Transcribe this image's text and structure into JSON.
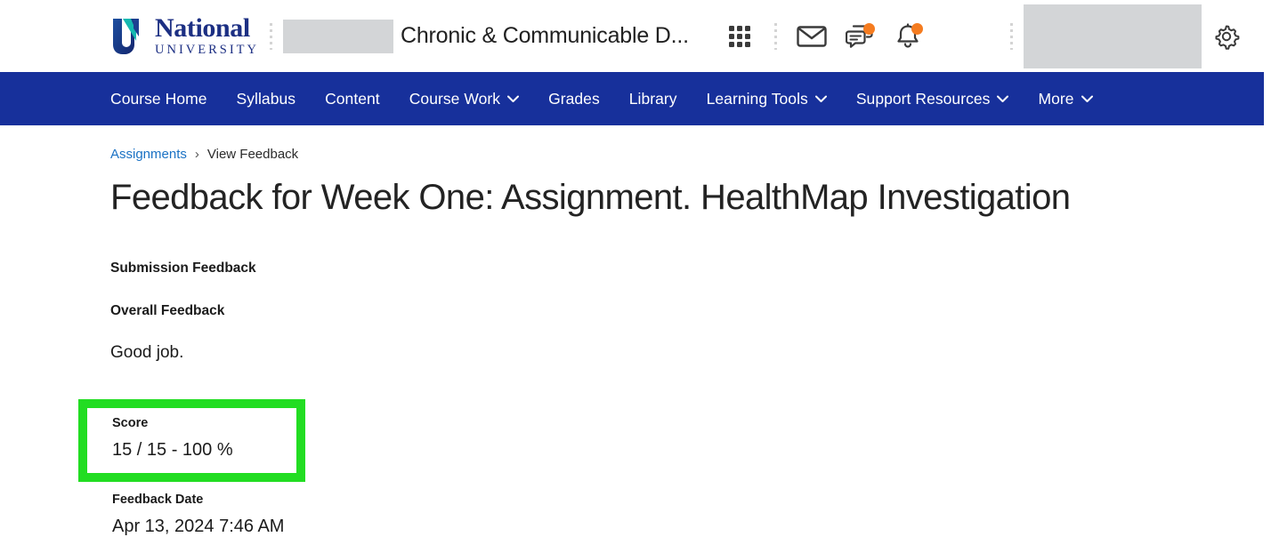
{
  "header": {
    "brand": {
      "name": "National",
      "sub": "UNIVERSITY",
      "logo_icon": "national-university-n-logo"
    },
    "course_title": "Chronic & Communicable D...",
    "redacted_course_label": "",
    "redacted_user_label": "",
    "icons": [
      {
        "name": "apps-grid-icon",
        "label": "Apps",
        "badge": false
      },
      {
        "name": "mail-envelope-icon",
        "label": "Mail",
        "badge": false
      },
      {
        "name": "chat-bubbles-icon",
        "label": "Messages",
        "badge": true
      },
      {
        "name": "bell-notification-icon",
        "label": "Notifications",
        "badge": true
      }
    ],
    "settings_icon": "gear-icon",
    "badge_color": "#f57c20"
  },
  "nav": {
    "background_color": "#17309b",
    "items": [
      {
        "label": "Course Home",
        "has_dropdown": false
      },
      {
        "label": "Syllabus",
        "has_dropdown": false
      },
      {
        "label": "Content",
        "has_dropdown": false
      },
      {
        "label": "Course Work",
        "has_dropdown": true
      },
      {
        "label": "Grades",
        "has_dropdown": false
      },
      {
        "label": "Library",
        "has_dropdown": false
      },
      {
        "label": "Learning Tools",
        "has_dropdown": true
      },
      {
        "label": "Support Resources",
        "has_dropdown": true
      },
      {
        "label": "More",
        "has_dropdown": true
      }
    ]
  },
  "breadcrumb": {
    "link_label": "Assignments",
    "separator": "›",
    "current_label": "View Feedback"
  },
  "page": {
    "title": "Feedback for Week One: Assignment. HealthMap Investigation"
  },
  "feedback": {
    "submission_heading": "Submission Feedback",
    "overall_heading": "Overall Feedback",
    "overall_text": "Good job.",
    "score": {
      "label": "Score",
      "value": "15 / 15 - 100 %",
      "highlight_color": "#22dd22"
    },
    "date": {
      "label": "Feedback Date",
      "value": "Apr 13, 2024 7:46 AM"
    }
  }
}
